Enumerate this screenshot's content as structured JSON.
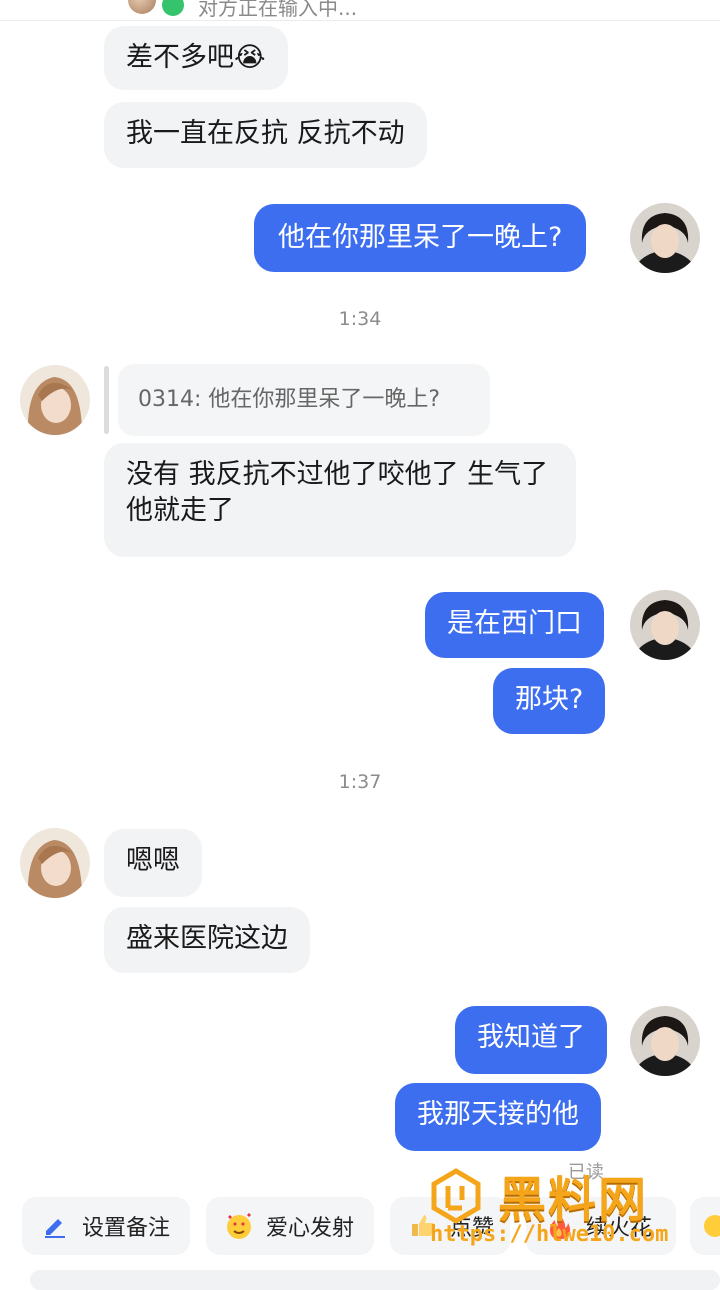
{
  "header": {
    "typing_status": "对方正在输入中..."
  },
  "messages": [
    {
      "text": "差不多吧😭"
    },
    {
      "text": "我一直在反抗 反抗不动"
    },
    {
      "text": "他在你那里呆了一晚上?"
    },
    {
      "text": "没有 我反抗不过他了咬他了 生气了他就走了"
    },
    {
      "text": "是在西门口"
    },
    {
      "text": "那块?"
    },
    {
      "text": "嗯嗯"
    },
    {
      "text": "盛来医院这边"
    },
    {
      "text": "我知道了"
    },
    {
      "text": "我那天接的他"
    }
  ],
  "timestamps": [
    "1:34",
    "1:37"
  ],
  "quote": {
    "text": "0314: 他在你那里呆了一晚上?"
  },
  "read_receipt": "已读",
  "actions": [
    {
      "label": "设置备注",
      "icon": "pencil-icon"
    },
    {
      "label": "爱心发射",
      "icon": "heart-face-emoji-icon"
    },
    {
      "label": "点赞",
      "icon": "thumbs-up-icon"
    },
    {
      "label": "续火花",
      "icon": "fire-icon"
    }
  ],
  "watermark": {
    "title": "黑料网",
    "url": "https://hlwe10.com"
  },
  "colors": {
    "outgoing_bubble": "#3d6ef0",
    "incoming_bubble": "#f2f3f5",
    "watermark": "#f5a51a"
  }
}
